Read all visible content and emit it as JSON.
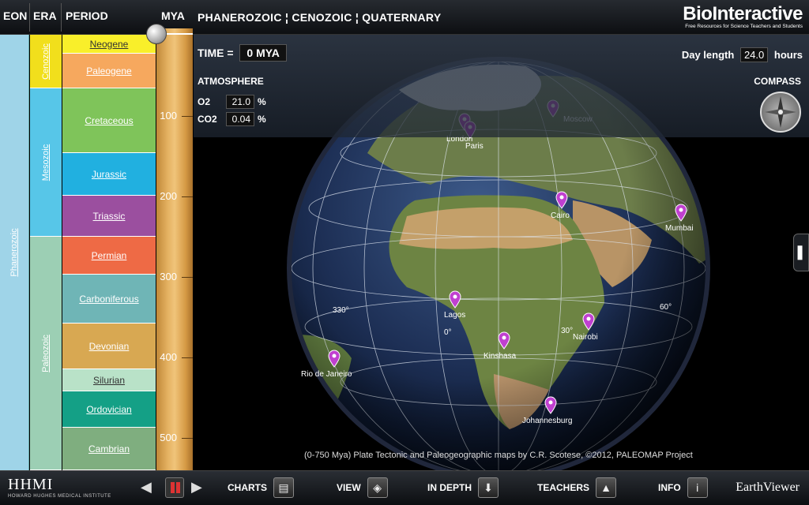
{
  "header": {
    "eon_label": "EON",
    "era_label": "ERA",
    "period_label": "PERIOD",
    "mya_label": "MYA",
    "breadcrumb": "PHANEROZOIC ¦ CENOZOIC ¦ QUATERNARY",
    "logo": "BioInteractive",
    "logo_sub": "Free Resources for Science Teachers and Students"
  },
  "timeline": {
    "eon": "Phanerozoic",
    "eras": [
      {
        "name": "Cenozoic",
        "color": "#f1df1c"
      },
      {
        "name": "Mesozoic",
        "color": "#57c6e8"
      },
      {
        "name": "Paleozoic",
        "color": "#9ccfb4"
      }
    ],
    "periods": [
      {
        "name": "Neogene",
        "color": "#f9ef2a"
      },
      {
        "name": "Paleogene",
        "color": "#f6a85e"
      },
      {
        "name": "Cretaceous",
        "color": "#7fc45a"
      },
      {
        "name": "Jurassic",
        "color": "#21b0e0"
      },
      {
        "name": "Triassic",
        "color": "#9b4f9f"
      },
      {
        "name": "Permian",
        "color": "#ee6a45"
      },
      {
        "name": "Carboniferous",
        "color": "#6fb5b6"
      },
      {
        "name": "Devonian",
        "color": "#d8a852"
      },
      {
        "name": "Silurian",
        "color": "#b9e2c8"
      },
      {
        "name": "Ordovician",
        "color": "#14a086"
      },
      {
        "name": "Cambrian",
        "color": "#7fae7f"
      }
    ],
    "ruler_ticks": [
      "100",
      "200",
      "300",
      "400",
      "500"
    ]
  },
  "panel": {
    "time_label": "TIME =",
    "time_value": "0 MYA",
    "day_length_label": "Day length",
    "day_length_value": "24.0",
    "day_length_unit": "hours",
    "atmosphere_label": "ATMOSPHERE",
    "o2_label": "O2",
    "o2_value": "21.0",
    "co2_label": "CO2",
    "co2_value": "0.04",
    "percent": "%",
    "compass_label": "COMPASS"
  },
  "globe": {
    "cities": [
      "Moscow",
      "London",
      "Paris",
      "Cairo",
      "Mumbai",
      "Lagos",
      "Nairobi",
      "Kinshasa",
      "Rio de Janeiro",
      "Johannesburg"
    ],
    "longitude_labels": [
      "330°",
      "0°",
      "30°",
      "60°"
    ],
    "credit": "(0-750 Mya) Plate Tectonic and Paleogeographic maps by C.R. Scotese, ©2012, PALEOMAP Project",
    "pin_color": "#c040d0"
  },
  "toolbar": {
    "hhmi": "HHMI",
    "hhmi_sub": "HOWARD HUGHES MEDICAL INSTITUTE",
    "charts": "CHARTS",
    "view": "VIEW",
    "in_depth": "IN DEPTH",
    "teachers": "TEACHERS",
    "info": "INFO",
    "app_name": "EarthViewer"
  }
}
